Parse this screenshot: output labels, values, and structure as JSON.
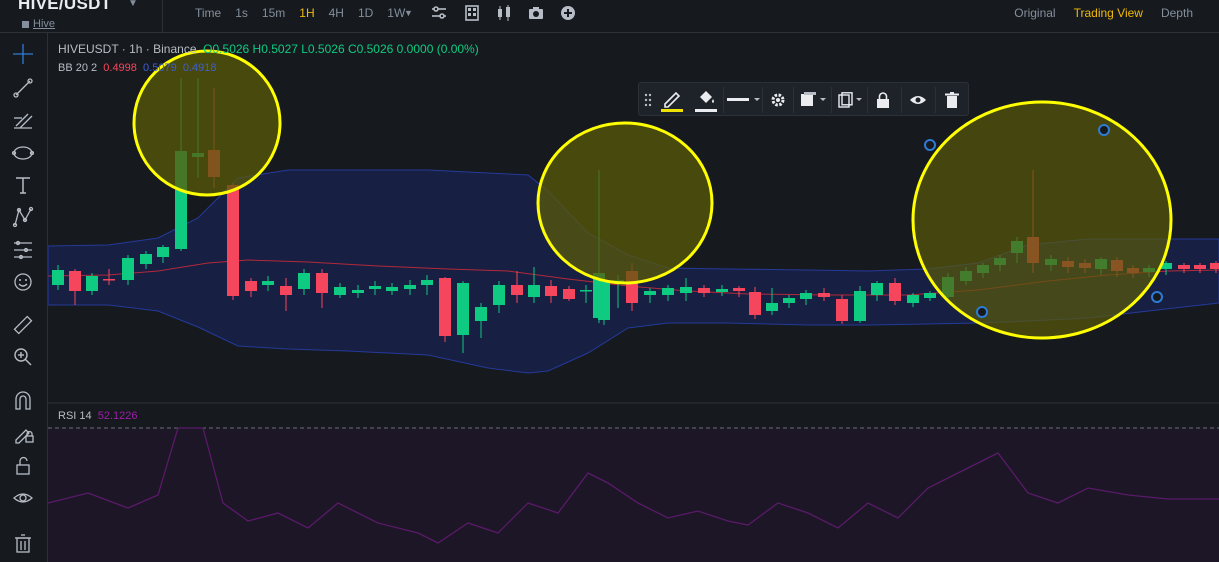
{
  "header": {
    "symbol": "HIVE/USDT",
    "symbol_sub": "Hive",
    "intervals": [
      "Time",
      "1s",
      "15m",
      "1H",
      "4H",
      "1D",
      "1W"
    ],
    "active_interval": "1H",
    "views": [
      "Original",
      "Trading View",
      "Depth"
    ],
    "active_view": "Trading View"
  },
  "legend": {
    "pair": "HIVEUSDT · 1h · Binance",
    "ohlc": "O0.5026  H0.5027  L0.5026  C0.5026  0.0000 (0.00%)",
    "bb_label": "BB 20 2",
    "bb_mid": "0.4998",
    "bb_upper": "0.5079",
    "bb_lower": "0.4918"
  },
  "rsi": {
    "label": "RSI 14",
    "value": "52.1226"
  },
  "colors": {
    "up": "#0ecb81",
    "down": "#f6465d",
    "accent": "#f0b90b",
    "bb_band": "#1f2b6b",
    "rsi_line": "#6a1e78",
    "highlight": "#ffff00"
  },
  "left_tools": [
    "crosshair-icon",
    "trendline-icon",
    "fib-icon",
    "ellipse-tool-icon",
    "text-tool-icon",
    "pattern-icon",
    "measure-icon",
    "emoji-icon",
    "ruler-icon",
    "zoom-in-icon",
    "magnet-icon",
    "lock-drawing-icon",
    "unlock-icon",
    "eye-icon",
    "trash-icon"
  ],
  "draw_toolbar_tools": [
    "drag-handle-icon",
    "pencil-color-icon",
    "fill-color-icon",
    "line-style-icon",
    "settings-icon",
    "template-icon",
    "clone-icon",
    "lock-icon",
    "visibility-icon",
    "delete-icon"
  ]
}
